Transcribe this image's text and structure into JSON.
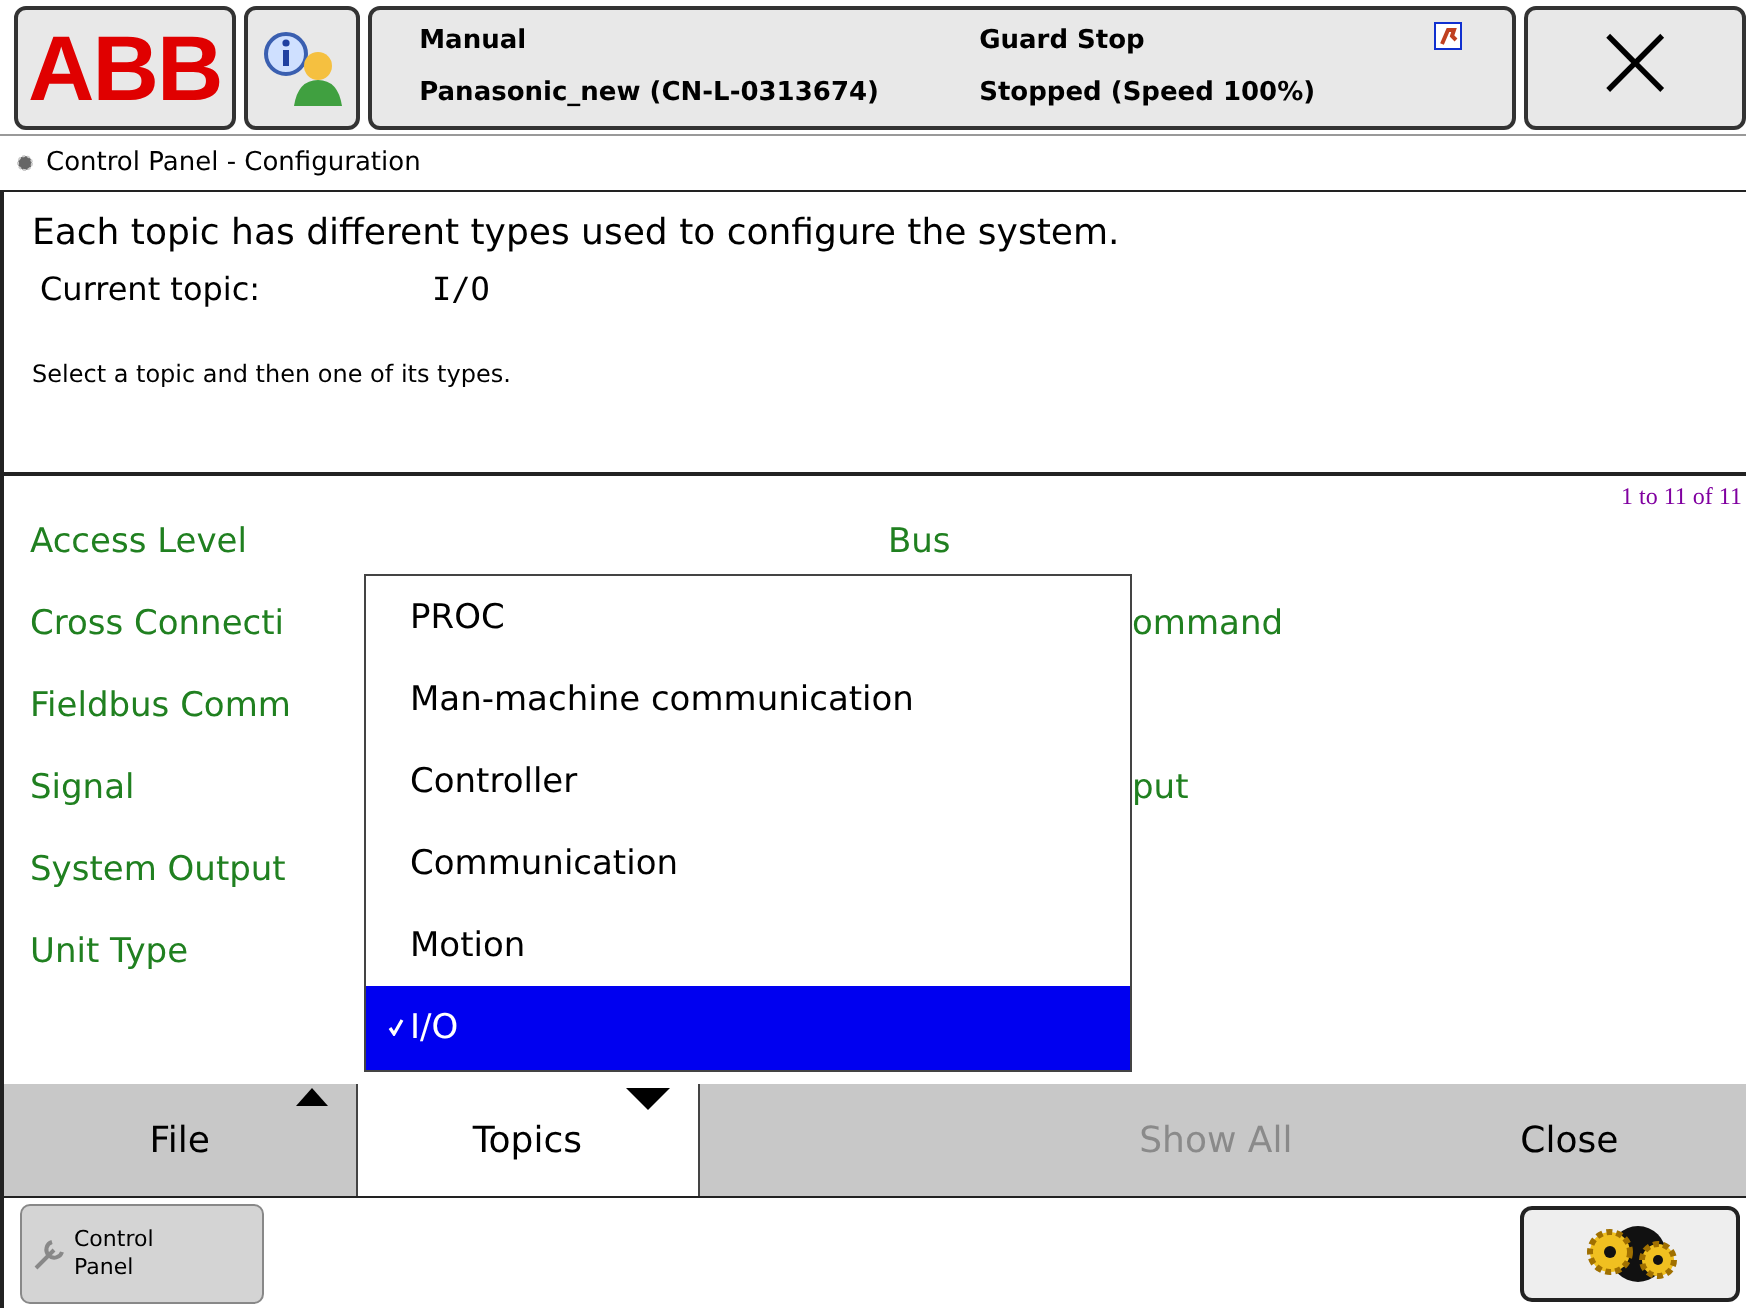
{
  "header": {
    "logo": "ABB",
    "status": {
      "mode": "Manual",
      "system": "Panasonic_new (CN-L-0313674)",
      "state": "Guard Stop",
      "run": "Stopped (Speed 100%)"
    },
    "close": "×"
  },
  "title": "Control Panel - Configuration",
  "intro": {
    "description": "Each topic has different types used to configure the system.",
    "topic_label": "Current topic:",
    "topic_value": "I/O",
    "hint": "Select a topic and then one of its types."
  },
  "list": {
    "range": "1 to 11 of 11",
    "left": [
      {
        "label": "Access Level"
      },
      {
        "label": "Cross Connecti"
      },
      {
        "label": "Fieldbus Comm"
      },
      {
        "label": "Signal"
      },
      {
        "label": "System Output"
      },
      {
        "label": "Unit Type"
      }
    ],
    "right": [
      {
        "label": "Bus",
        "kind": "whole"
      },
      {
        "label": "ommand",
        "kind": "cut"
      },
      {
        "kind": "blank"
      },
      {
        "label": "put",
        "kind": "cut"
      }
    ]
  },
  "topics_menu": [
    {
      "label": "PROC",
      "selected": false
    },
    {
      "label": "Man-machine communication",
      "selected": false
    },
    {
      "label": "Controller",
      "selected": false
    },
    {
      "label": "Communication",
      "selected": false
    },
    {
      "label": "Motion",
      "selected": false
    },
    {
      "label": "I/O",
      "selected": true
    }
  ],
  "menu_bar": [
    {
      "label": "File",
      "kind": "up",
      "open": false,
      "disabled": false
    },
    {
      "label": "Topics",
      "kind": "down",
      "open": true,
      "disabled": false
    },
    {
      "label": "Show All",
      "kind": "plain",
      "open": false,
      "disabled": true
    },
    {
      "label": "Close",
      "kind": "plain",
      "open": false,
      "disabled": false
    }
  ],
  "taskbar": {
    "app": "Control Panel"
  }
}
